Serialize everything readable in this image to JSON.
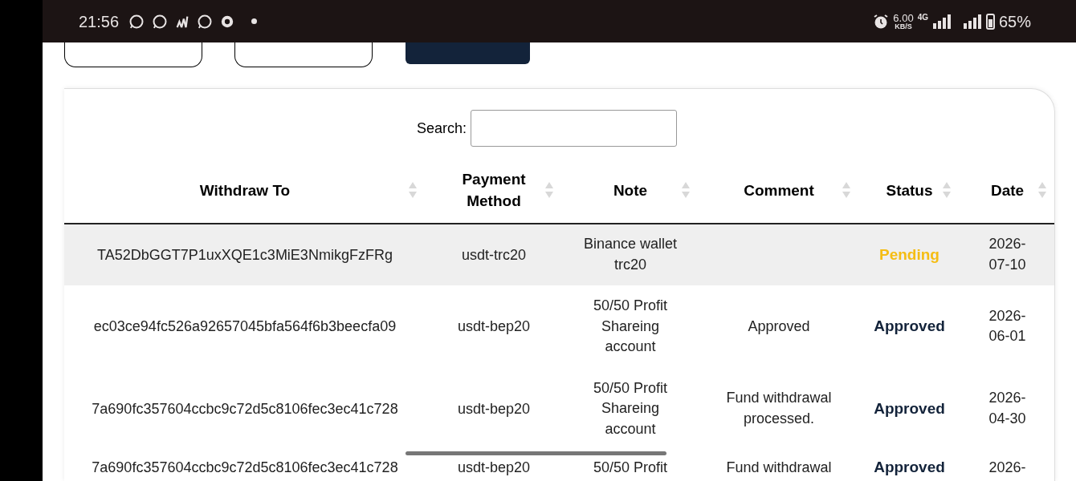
{
  "status_bar": {
    "time": "21:56",
    "network_speed": "6.00",
    "speed_unit": "KB/S",
    "network_type": "4G",
    "battery": "65%"
  },
  "table": {
    "search_label": "Search:",
    "columns": [
      {
        "label": "Withdraw To"
      },
      {
        "label": "Payment Method"
      },
      {
        "label": "Note"
      },
      {
        "label": "Comment"
      },
      {
        "label": "Status"
      },
      {
        "label": "Date"
      }
    ],
    "rows": [
      {
        "withdraw_to": "TA52DbGGT7P1uxXQE1c3MiE3NmikgFzFRg",
        "payment_method": "usdt-trc20",
        "note": "Binance wallet trc20",
        "comment": "",
        "status": "Pending",
        "color": "#f5bd14",
        "selected": true,
        "date": "2026-07-10"
      },
      {
        "withdraw_to": "ec03ce94fc526a92657045bfa564f6b3beecfa09",
        "payment_method": "usdt-bep20",
        "note": "50/50 Profit Shareing account",
        "comment": "Approved",
        "status": "Approved",
        "color": "#13233a",
        "selected": false,
        "date": "2026-06-01"
      },
      {
        "withdraw_to": "7a690fc357604ccbc9c72d5c8106fec3ec41c728",
        "payment_method": "usdt-bep20",
        "note": "50/50 Profit Shareing account",
        "comment": "Fund withdrawal processed.",
        "status": "Approved",
        "color": "#13233a",
        "selected": false,
        "date": "2026-04-30"
      },
      {
        "withdraw_to": "7a690fc357604ccbc9c72d5c8106fec3ec41c728",
        "payment_method": "usdt-bep20",
        "note": "50/50 Profit",
        "comment": "Fund withdrawal",
        "status": "Approved",
        "color": "#13233a",
        "selected": false,
        "date": "2026-"
      }
    ]
  }
}
